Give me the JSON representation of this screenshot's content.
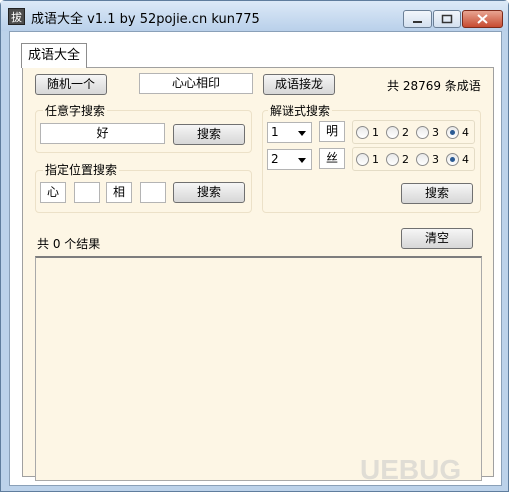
{
  "window": {
    "title": "成语大全 v1.1 by 52pojie.cn kun775",
    "icon_glyph": "拔"
  },
  "tab": {
    "label": "成语大全"
  },
  "top": {
    "random_button": "随机一个",
    "current_idiom": "心心相印",
    "chain_button": "成语接龙",
    "count_text": "共 28769 条成语"
  },
  "any_search": {
    "title": "任意字搜索",
    "value": "好",
    "button": "搜索"
  },
  "pos_search": {
    "title": "指定位置搜索",
    "fields": [
      "心",
      "",
      "相",
      ""
    ],
    "button": "搜索"
  },
  "riddle_search": {
    "title": "解谜式搜索",
    "rows": [
      {
        "combo": "1",
        "char": "明",
        "options": [
          "1",
          "2",
          "3",
          "4"
        ],
        "selected": "4"
      },
      {
        "combo": "2",
        "char": "丝",
        "options": [
          "1",
          "2",
          "3",
          "4"
        ],
        "selected": "4"
      }
    ],
    "button": "搜索"
  },
  "results": {
    "summary": "共 0 个结果",
    "clear_button": "清空"
  },
  "watermark": "UEBUG"
}
